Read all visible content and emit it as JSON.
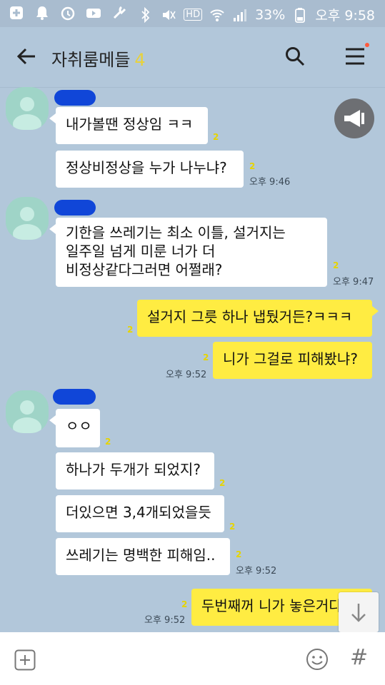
{
  "status_bar": {
    "battery": "33%",
    "time": "오후 9:58",
    "hd": "HD",
    "icons": [
      "add-box-icon",
      "bell-icon",
      "alarm-icon",
      "youtube-icon",
      "wrench-icon",
      "bluetooth-icon",
      "mute-icon",
      "wifi-icon",
      "signal-icon",
      "battery-icon"
    ]
  },
  "header": {
    "title": "자취룸메들",
    "count": "4",
    "icons": [
      "back-arrow-icon",
      "search-icon",
      "menu-icon"
    ]
  },
  "messages": [
    {
      "text": "내가볼땐 정상임 ㅋㅋ",
      "unread": "2",
      "time": ""
    },
    {
      "text": "정상비정상을 누가 나누냐?",
      "unread": "2",
      "time": "오후 9:46"
    },
    {
      "line1": "기한을 쓰레기는 최소 이틀, 설거지는",
      "line2": "일주일 넘게 미룬 너가 더",
      "line3": "비정상같다그러면 어쩔래?",
      "unread": "2",
      "time": "오후 9:47"
    },
    {
      "text": "설거지 그릇 하나 냅뒀거든?ㅋㅋㅋ",
      "unread": "2",
      "time": ""
    },
    {
      "text": "니가 그걸로 피해봤냐?",
      "unread": "2",
      "time": "오후 9:52"
    },
    {
      "text": "ㅇㅇ",
      "unread": "2",
      "time": ""
    },
    {
      "text": "하나가 두개가 되었지?",
      "unread": "2",
      "time": ""
    },
    {
      "text": "더있으면 3,4개되었을듯",
      "unread": "2",
      "time": ""
    },
    {
      "text": "쓰레기는 명백한 피해임..",
      "unread": "2",
      "time": "오후 9:52"
    },
    {
      "text": "두번째꺼 니가 놓은거다",
      "unread": "2",
      "time": "오후 9:52"
    }
  ],
  "colors": {
    "background": "#b2c7da",
    "my_bubble": "#ffec42",
    "other_bubble": "#ffffff",
    "unread": "#e6d400",
    "name_redaction": "#1046d8"
  },
  "bottom_bar": {
    "icons": [
      "plus-box-icon",
      "emoji-icon",
      "hash-icon"
    ],
    "hash": "#"
  }
}
